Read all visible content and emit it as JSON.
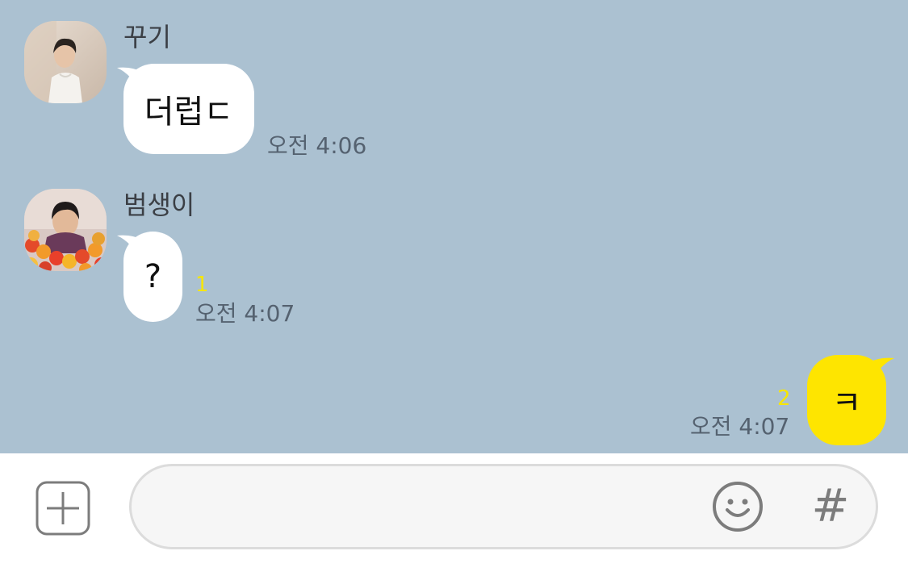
{
  "chat": {
    "messages": [
      {
        "sender": "꾸기",
        "text": "더럽ㄷ",
        "time": "오전 4:06",
        "unread": "",
        "avatar_icon": "profile-photo-man-white-shirt"
      },
      {
        "sender": "범생이",
        "text": "?",
        "time": "오전 4:07",
        "unread": "1",
        "avatar_icon": "profile-photo-man-in-flowers"
      },
      {
        "sender": "",
        "text": "ㅋ",
        "time": "오전 4:07",
        "unread": "2",
        "avatar_icon": ""
      }
    ],
    "background_color": "#abc1d1",
    "incoming_bubble_color": "#ffffff",
    "outgoing_bubble_color": "#fee500",
    "unread_color": "#f7e600"
  },
  "input_bar": {
    "placeholder": "",
    "value": "",
    "plus_icon": "plus-square-icon",
    "emoji_icon": "smiley-icon",
    "hash_label": "#"
  }
}
